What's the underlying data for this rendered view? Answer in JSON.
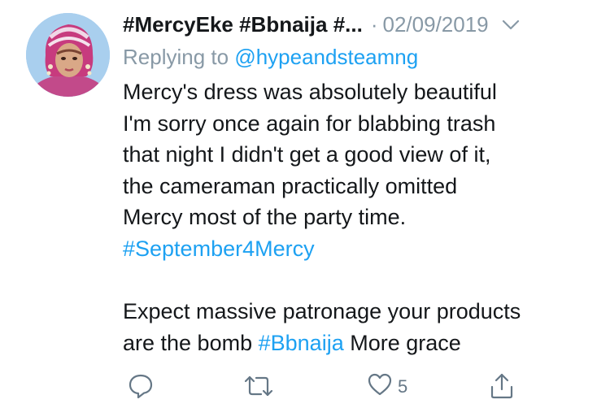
{
  "tweet": {
    "display_name": "#MercyEke #Bbnaija #...",
    "separator": "·",
    "timestamp": "02/09/2019",
    "replying_prefix": "Replying to",
    "replying_to": "@hypeandsteamng",
    "lines": [
      "Mercy's dress was absolutely beautiful",
      "I'm sorry once again for blabbing trash",
      "that night I didn't get a good view of it,",
      "the cameraman practically omitted",
      "Mercy most of the party time."
    ],
    "hashtag1": "#September4Mercy",
    "line_a": "Expect massive patronage your products",
    "line_b_start": "are the bomb",
    "hashtag2": "#Bbnaija",
    "line_b_end": "More grace",
    "like_count": "5"
  },
  "icons": {
    "caret": "chevron-down-icon",
    "reply": "reply-icon",
    "retweet": "retweet-icon",
    "like": "heart-icon",
    "share": "share-icon"
  },
  "colors": {
    "link": "#1da1f2",
    "secondary": "#8899a6",
    "text": "#14171a"
  }
}
